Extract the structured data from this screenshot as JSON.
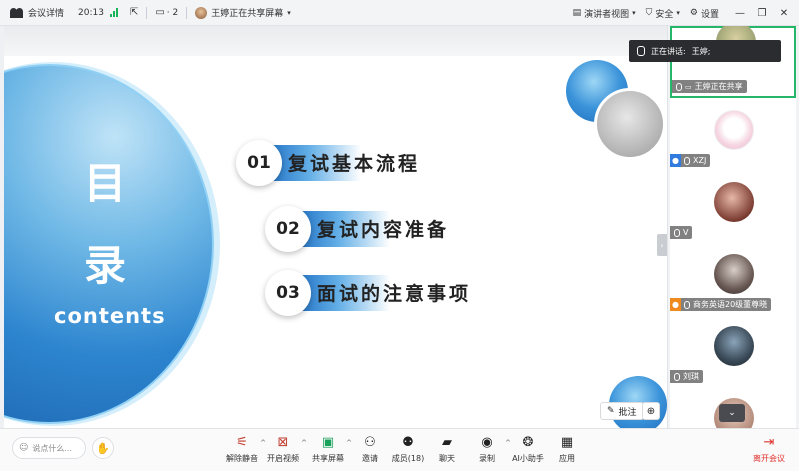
{
  "topbar": {
    "meeting_details": "会议详情",
    "time": "20:13",
    "screen_count": "· 2",
    "sharer": "王婷正在共享屏幕",
    "presenter_view": "演讲者视图",
    "security": "安全",
    "settings": "设置"
  },
  "slide": {
    "title_line1": "目",
    "title_line2": "录",
    "subtitle": "contents",
    "items": [
      {
        "num": "01",
        "text": "复试基本流程"
      },
      {
        "num": "02",
        "text": "复试内容准备"
      },
      {
        "num": "03",
        "text": "面试的注意事项"
      }
    ],
    "annotate": "批注"
  },
  "speaking": {
    "label": "正在讲话:",
    "name": "王婷;"
  },
  "participants": [
    {
      "name": "王婷正在共享"
    },
    {
      "name": "XZJ"
    },
    {
      "name": "V"
    },
    {
      "name": "商务英语20级董尊晓"
    },
    {
      "name": "刘琪"
    }
  ],
  "toolbar": {
    "chat_placeholder": "说点什么...",
    "unmute": "解除静音",
    "start_video": "开启视频",
    "share_screen": "共享屏幕",
    "invite": "邀请",
    "members": "成员(18)",
    "chat": "聊天",
    "record": "录制",
    "ai_assistant": "AI小助手",
    "apps": "应用",
    "leave": "离开会议"
  },
  "colors": {
    "accent_blue": "#1e6cbe",
    "active_speaker": "#26b66a",
    "leave_red": "#e0312d"
  }
}
